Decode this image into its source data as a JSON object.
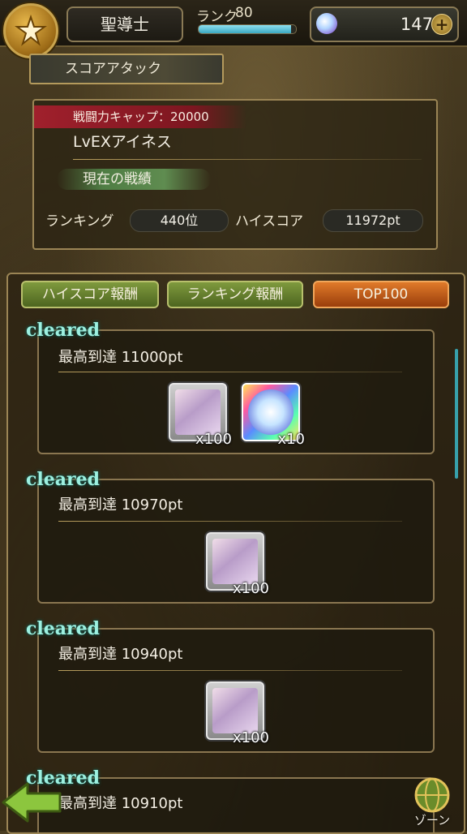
{
  "header": {
    "class_name": "聖導士",
    "rank_label": "ランク",
    "rank_value": "80",
    "rank_progress": 0.95,
    "gem_count": "147",
    "plus_label": "+"
  },
  "section_title": "スコアアタック",
  "info": {
    "power_cap": "戦闘力キャップ：20000",
    "stage_name": "LvEXアイネス",
    "current_record": "現在の戦績",
    "ranking_label": "ランキング",
    "ranking_value": "440位",
    "highscore_label": "ハイスコア",
    "highscore_value": "11972pt"
  },
  "tabs": [
    {
      "label": "ハイスコア報酬",
      "color": "green"
    },
    {
      "label": "ランキング報酬",
      "color": "green"
    },
    {
      "label": "TOP100",
      "color": "orange"
    }
  ],
  "rewards": [
    {
      "status": "cleared",
      "score": "最高到達 11000pt",
      "items": [
        {
          "icon": "crystal-shard-icon",
          "qty": "x100"
        },
        {
          "icon": "rainbow-gem-icon",
          "qty": "x10"
        }
      ]
    },
    {
      "status": "cleared",
      "score": "最高到達 10970pt",
      "items": [
        {
          "icon": "crystal-shard-icon",
          "qty": "x100"
        }
      ]
    },
    {
      "status": "cleared",
      "score": "最高到達 10940pt",
      "items": [
        {
          "icon": "crystal-shard-icon",
          "qty": "x100"
        }
      ]
    },
    {
      "status": "cleared",
      "score": "最高到達 10910pt",
      "items": []
    }
  ],
  "footer": {
    "zone_label": "ゾーン"
  },
  "colors": {
    "cleared_text": "#9df0e0",
    "tab_green": "#5e7a2c",
    "tab_orange": "#c85a18",
    "cap_banner": "#a0202c"
  }
}
